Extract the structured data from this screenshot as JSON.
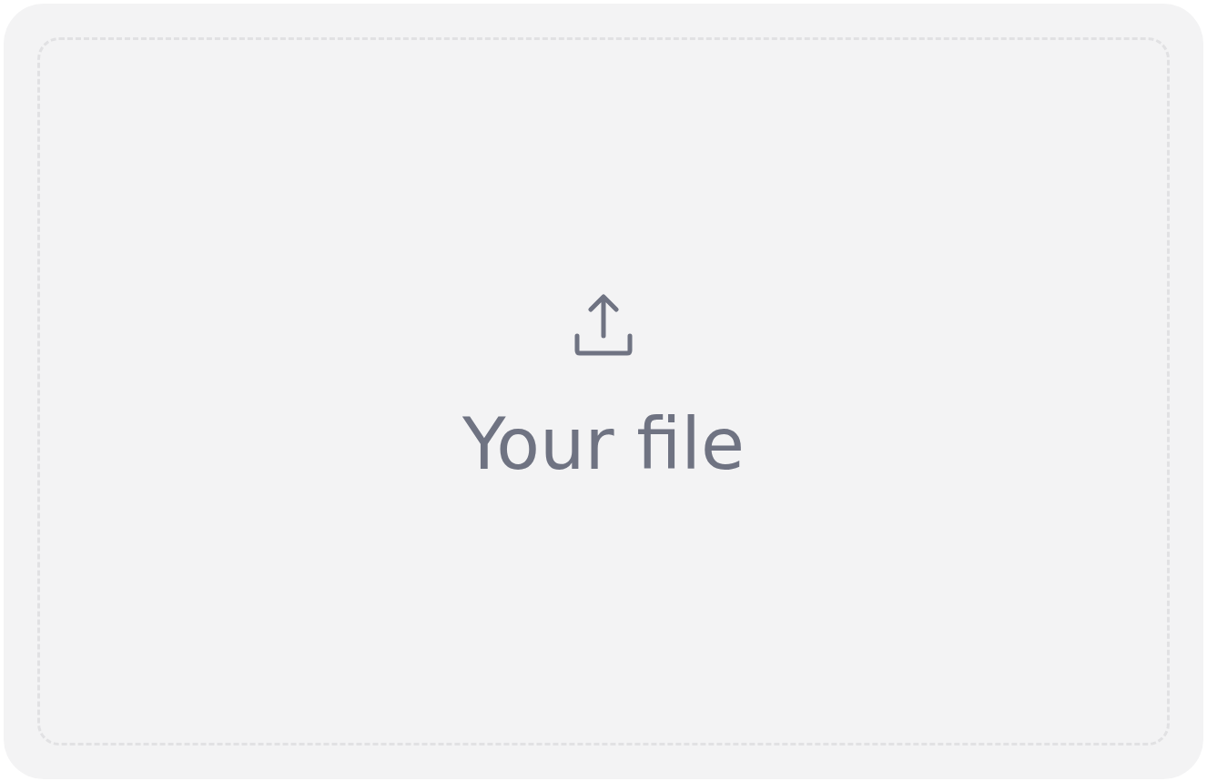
{
  "dropzone": {
    "label": "Your file"
  }
}
